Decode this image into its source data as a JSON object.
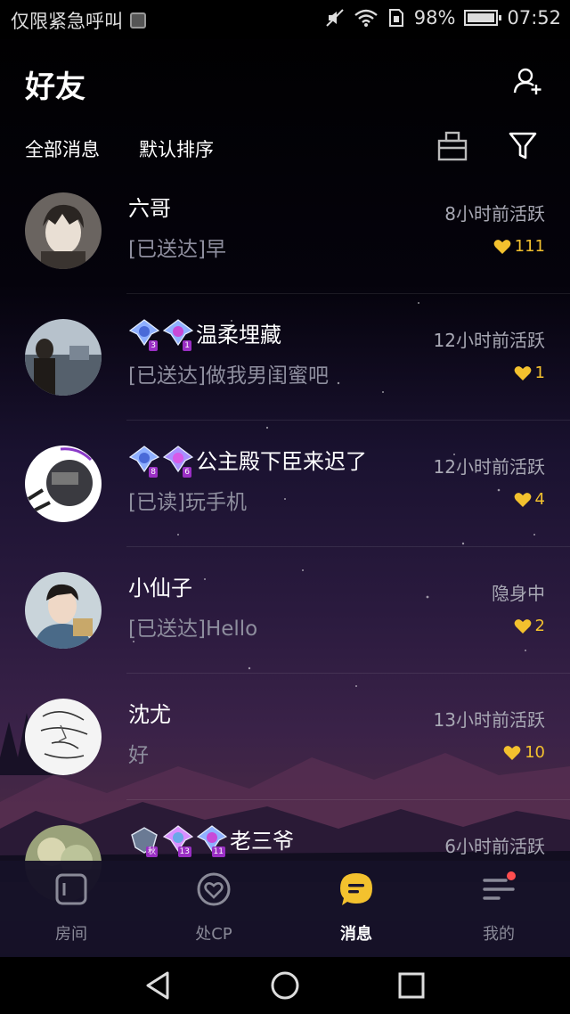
{
  "status_bar": {
    "carrier_text": "仅限紧急呼叫",
    "battery_percent": "98%",
    "battery_level": 0.98,
    "time": "07:52"
  },
  "header": {
    "title": "好友",
    "filter_all": "全部消息",
    "sort_default": "默认排序"
  },
  "friends": [
    {
      "name": "六哥",
      "active": "8小时前活跃",
      "message": "[已送达]早",
      "hearts": "111",
      "badges": []
    },
    {
      "name": "温柔埋藏",
      "active": "12小时前活跃",
      "message": "[已送达]做我男闺蜜吧",
      "hearts": "1",
      "badges": [
        "3",
        "1"
      ]
    },
    {
      "name": "公主殿下臣来迟了",
      "active": "12小时前活跃",
      "message": "[已读]玩手机",
      "hearts": "4",
      "badges": [
        "8",
        "6"
      ]
    },
    {
      "name": "小仙子",
      "active": "隐身中",
      "message": "[已送达]Hello",
      "hearts": "2",
      "badges": []
    },
    {
      "name": "沈尤",
      "active": "13小时前活跃",
      "message": "好",
      "hearts": "10",
      "badges": []
    },
    {
      "name": "老三爷",
      "active": "6小时前活跃",
      "message": "",
      "hearts": "",
      "badges": [
        "秋",
        "13",
        "11"
      ]
    }
  ],
  "tabs": [
    {
      "label": "房间",
      "icon": "room-icon"
    },
    {
      "label": "处CP",
      "icon": "cp-heart-icon"
    },
    {
      "label": "消息",
      "icon": "message-bubble-icon"
    },
    {
      "label": "我的",
      "icon": "profile-menu-icon"
    }
  ],
  "colors": {
    "accent_yellow": "#f3c12e",
    "badge_purple": "#9a2fc4",
    "notification_red": "#ff4d4f"
  }
}
